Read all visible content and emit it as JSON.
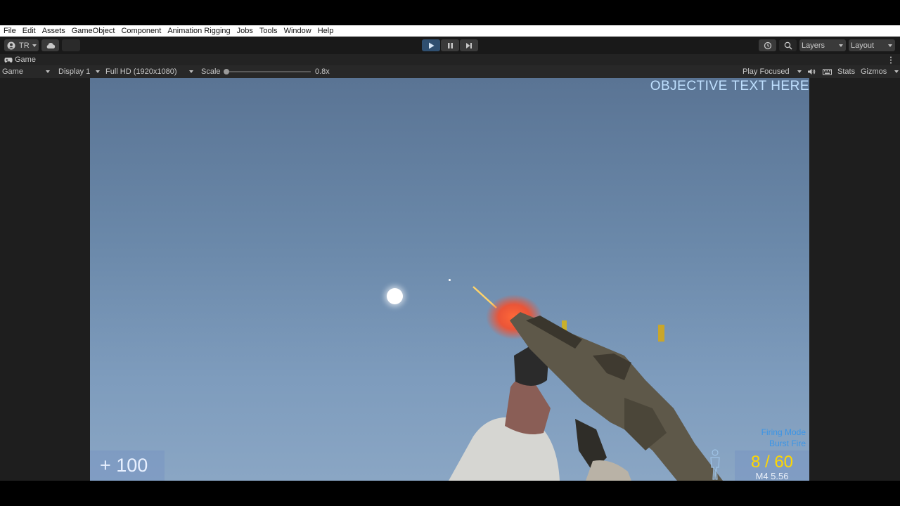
{
  "menu": [
    "File",
    "Edit",
    "Assets",
    "GameObject",
    "Component",
    "Animation Rigging",
    "Jobs",
    "Tools",
    "Window",
    "Help"
  ],
  "toolbar": {
    "account_label": "TR",
    "layers_label": "Layers",
    "layout_label": "Layout"
  },
  "tab": {
    "title": "Game"
  },
  "controls": {
    "view_mode": "Game",
    "display": "Display 1",
    "resolution": "Full HD (1920x1080)",
    "scale_label": "Scale",
    "scale_value": "0.8x",
    "play_focused": "Play Focused",
    "stats": "Stats",
    "gizmos": "Gizmos"
  },
  "hud": {
    "objective": "OBJECTIVE TEXT HERE",
    "health": "+ 100",
    "firing_mode_title": "Firing Mode",
    "firing_mode_value": "Burst Fire",
    "ammo": "8 / 60",
    "weapon": "M4 5.56"
  },
  "colors": {
    "play_active": "#2f4f70",
    "objective_text": "#bfe0ff",
    "ammo_text": "#ffd700",
    "fire_mode_text": "#3b95e6"
  },
  "icons": [
    "account-icon",
    "cloud-icon",
    "play-icon",
    "pause-icon",
    "step-icon",
    "history-icon",
    "search-icon",
    "gamepad-icon",
    "kebab-menu-icon",
    "audio-icon",
    "keyboard-icon",
    "player-silhouette-icon"
  ]
}
